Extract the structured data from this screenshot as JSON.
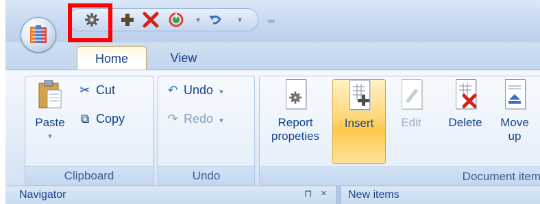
{
  "quick_access": {
    "icons": [
      "gear-icon",
      "add-icon",
      "delete-icon",
      "refresh-icon",
      "undo-icon"
    ],
    "highlight_color": "#ff0000"
  },
  "tabs": [
    {
      "label": "Home",
      "active": true
    },
    {
      "label": "View",
      "active": false
    }
  ],
  "groups": {
    "clipboard": {
      "label": "Clipboard",
      "paste": "Paste",
      "cut": "Cut",
      "copy": "Copy"
    },
    "undo": {
      "label": "Undo",
      "undo": "Undo",
      "redo": "Redo"
    },
    "document_item": {
      "label": "Document item",
      "report_properties_line1": "Report",
      "report_properties_line2": "propeties",
      "insert": "Insert",
      "edit": "Edit",
      "delete": "Delete",
      "move_up_line1": "Move",
      "move_up_line2": "up"
    }
  },
  "panes": {
    "left_title": "Navigator",
    "pin": "⊓",
    "close": "×",
    "right_title": "New items"
  },
  "colors": {
    "accent_text": "#15428b",
    "selected_button": "#ffc84a",
    "delete_red": "#d4211c"
  }
}
